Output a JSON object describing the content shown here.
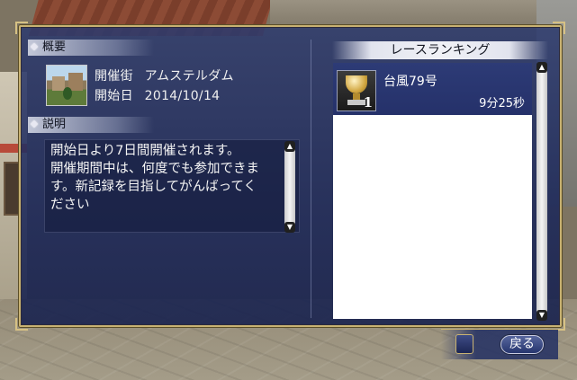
{
  "overview": {
    "label": "概要",
    "town_label": "開催街",
    "town_value": "アムステルダム",
    "start_label": "開始日",
    "start_value": "2014/10/14"
  },
  "description": {
    "label": "説明",
    "lines": [
      "開始日より7日間開催されます。",
      "開催期間中は、何度でも参加できま",
      "す。新記録を目指してがんばってく",
      "ださい"
    ]
  },
  "ranking": {
    "title": "レースランキング",
    "entries": [
      {
        "rank": "1",
        "name": "台風79号",
        "time": "9分25秒"
      }
    ]
  },
  "back_button": {
    "label": "戻る"
  },
  "icons": {
    "thumbnail": "town-thumbnail",
    "trophy": "trophy-icon",
    "scroll_up": "scroll-up-icon",
    "scroll_down": "scroll-down-icon"
  },
  "colors": {
    "panel_bg": "#2c3a6e",
    "frame_gold": "#c8b272",
    "list_bg": "#ffffff",
    "text": "#f0f0f0"
  }
}
